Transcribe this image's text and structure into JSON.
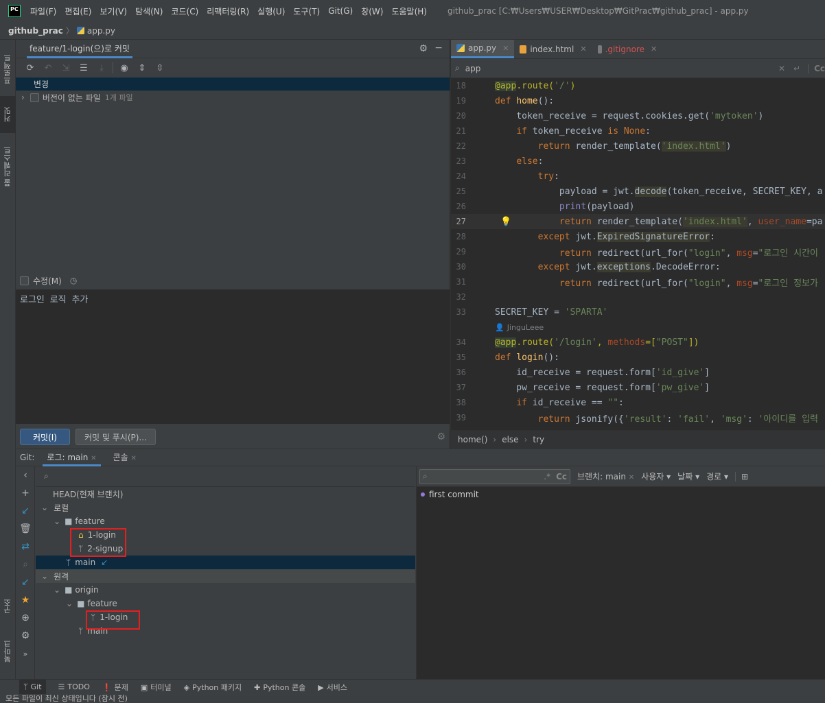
{
  "menubar": {
    "logo": "PC",
    "items": [
      "파일(F)",
      "편집(E)",
      "보기(V)",
      "탐색(N)",
      "코드(C)",
      "리팩터링(R)",
      "실행(U)",
      "도구(T)",
      "Git(G)",
      "창(W)",
      "도움말(H)"
    ],
    "title": "github_prac [C:₩Users₩USER₩Desktop₩GitPrac₩github_prac] - app.py"
  },
  "breadcrumb": {
    "project": "github_prac",
    "file": "app.py"
  },
  "left_strip": {
    "project": "프로젝트",
    "commit": "커밋",
    "pull_requests": "풀 리퀘스트",
    "structure": "구조",
    "bookmarks": "북마크"
  },
  "commit_panel": {
    "tab": "feature/1-login(으)로 커밋",
    "changes_label": "변경",
    "unversioned_label": "버전이 없는 파일",
    "unversioned_count": "1개 파일",
    "amend_label": "수정(M)",
    "message": "로그인 로직 추가",
    "commit_button": "커밋(I)",
    "commit_push_button": "커밋 및 푸시(P)..."
  },
  "editor": {
    "tabs": [
      {
        "label": "app.py",
        "color": "#bbbbbb"
      },
      {
        "label": "index.html",
        "color": "#bbbbbb"
      },
      {
        "label": ".gitignore",
        "color": "#d25252"
      }
    ],
    "search_value": "app",
    "search_cc": "Cc",
    "lines": {
      "l18": "18",
      "l19": "19",
      "l20": "20",
      "l21": "21",
      "l22": "22",
      "l23": "23",
      "l24": "24",
      "l25": "25",
      "l26": "26",
      "l27": "27",
      "l28": "28",
      "l29": "29",
      "l30": "30",
      "l31": "31",
      "l32": "32",
      "l33": "33",
      "l34": "34",
      "l35": "35",
      "l36": "36",
      "l37": "37",
      "l38": "38",
      "l39": "39"
    },
    "author": "JinguLeee",
    "breadcrumb": [
      "home()",
      "else",
      "try"
    ]
  },
  "git_panel": {
    "label": "Git:",
    "log_tab": "로그: main",
    "console_tab": "콘솔",
    "branches": {
      "head": "HEAD(현재 브랜치)",
      "local": "로컬",
      "feature": "feature",
      "b1": "1-login",
      "b2": "2-signup",
      "main": "main",
      "remote": "원격",
      "origin": "origin",
      "rfeature": "feature",
      "rb1": "1-login",
      "rmain": "main"
    },
    "log_filters": {
      "cc": "Cc",
      "branch": "브랜치: main",
      "user": "사용자",
      "date": "날짜",
      "path": "경로"
    },
    "commits": [
      "first commit"
    ]
  },
  "bottom_tabs": [
    "Git",
    "TODO",
    "문제",
    "터미널",
    "Python 패키지",
    "Python 콘솔",
    "서비스"
  ],
  "status": "모든 파일이 최신 상태입니다 (잠시 전)"
}
